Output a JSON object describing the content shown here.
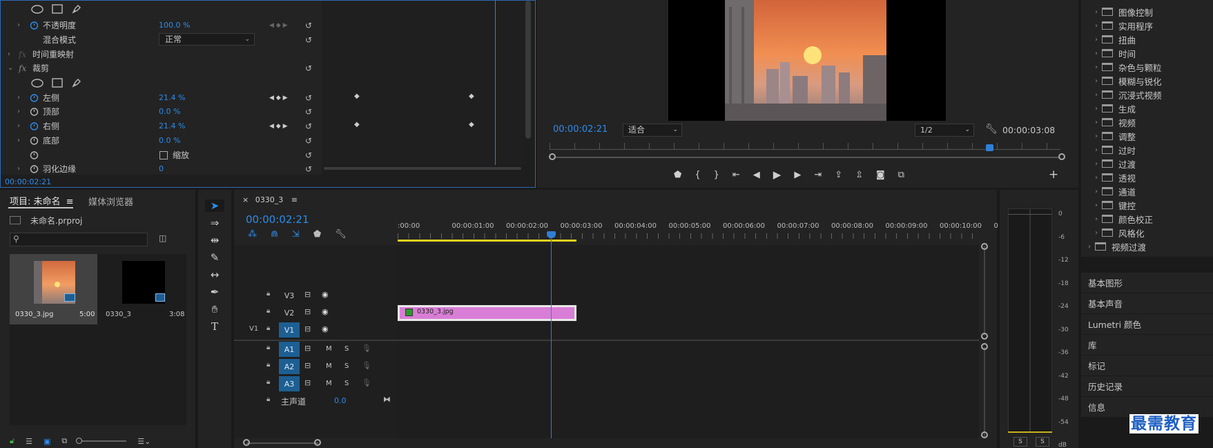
{
  "effect_controls": {
    "opacity_label": "不透明度",
    "opacity_value": "100.0 %",
    "blend_label": "混合模式",
    "blend_value": "正常",
    "time_remap_label": "时间重映射",
    "crop_label": "裁剪",
    "fx_glyph": "fx",
    "left_label": "左侧",
    "left_value": "21.4 %",
    "top_label": "顶部",
    "top_value": "0.0 %",
    "right_label": "右侧",
    "right_value": "21.4 %",
    "bottom_label": "底部",
    "bottom_value": "0.0 %",
    "zoom_label": "缩放",
    "feather_label": "羽化边缘",
    "feather_value": "0",
    "timecode": "00:00:02:21"
  },
  "program_monitor": {
    "current_time": "00:00:02:21",
    "fit_value": "适合",
    "resolution_value": "1/2",
    "duration": "00:00:03:08"
  },
  "project": {
    "tab_label": "项目: 未命名",
    "media_browser_label": "媒体浏览器",
    "file_name": "未命名.prproj",
    "items": [
      {
        "name": "0330_3.jpg",
        "duration": "5:00"
      },
      {
        "name": "0330_3",
        "duration": "3:08"
      }
    ]
  },
  "timeline": {
    "tab_label": "0330_3",
    "current_time": "00:00:02:21",
    "ruler": [
      ":00:00",
      "00:00:01:00",
      "00:00:02:00",
      "00:00:03:00",
      "00:00:04:00",
      "00:00:05:00",
      "00:00:06:00",
      "00:00:07:00",
      "00:00:08:00",
      "00:00:09:00",
      "00:00:10:00",
      "0"
    ],
    "tracks_video": [
      "V3",
      "V2",
      "V1"
    ],
    "source_patch": "V1",
    "tracks_audio": [
      "A1",
      "A2",
      "A3"
    ],
    "mute_label": "M",
    "solo_label": "S",
    "master_label": "主声道",
    "master_value": "0.0",
    "clip_label": "0330_3.jpg"
  },
  "audio_meter": {
    "scale": [
      "0",
      "-6",
      "-12",
      "-18",
      "-24",
      "-30",
      "-36",
      "-42",
      "-48",
      "-54",
      "dB"
    ],
    "solo_buttons": [
      "S",
      "S"
    ]
  },
  "effects_panel": {
    "folders": [
      "图像控制",
      "实用程序",
      "扭曲",
      "时间",
      "杂色与颗粒",
      "模糊与锐化",
      "沉浸式视频",
      "生成",
      "视频",
      "调整",
      "过时",
      "过渡",
      "透视",
      "通道",
      "键控",
      "颜色校正",
      "风格化"
    ],
    "bin_label": "视频过渡"
  },
  "side_panels": [
    "基本图形",
    "基本声音",
    "Lumetri 颜色",
    "库",
    "标记",
    "历史记录",
    "信息"
  ],
  "watermark": "最需教育",
  "colors": {
    "accent_blue": "#2d8ceb",
    "clip_pink": "#d97ed6",
    "playhead_blue": "#2f7fd6",
    "work_area_yellow": "#e8d21c"
  }
}
